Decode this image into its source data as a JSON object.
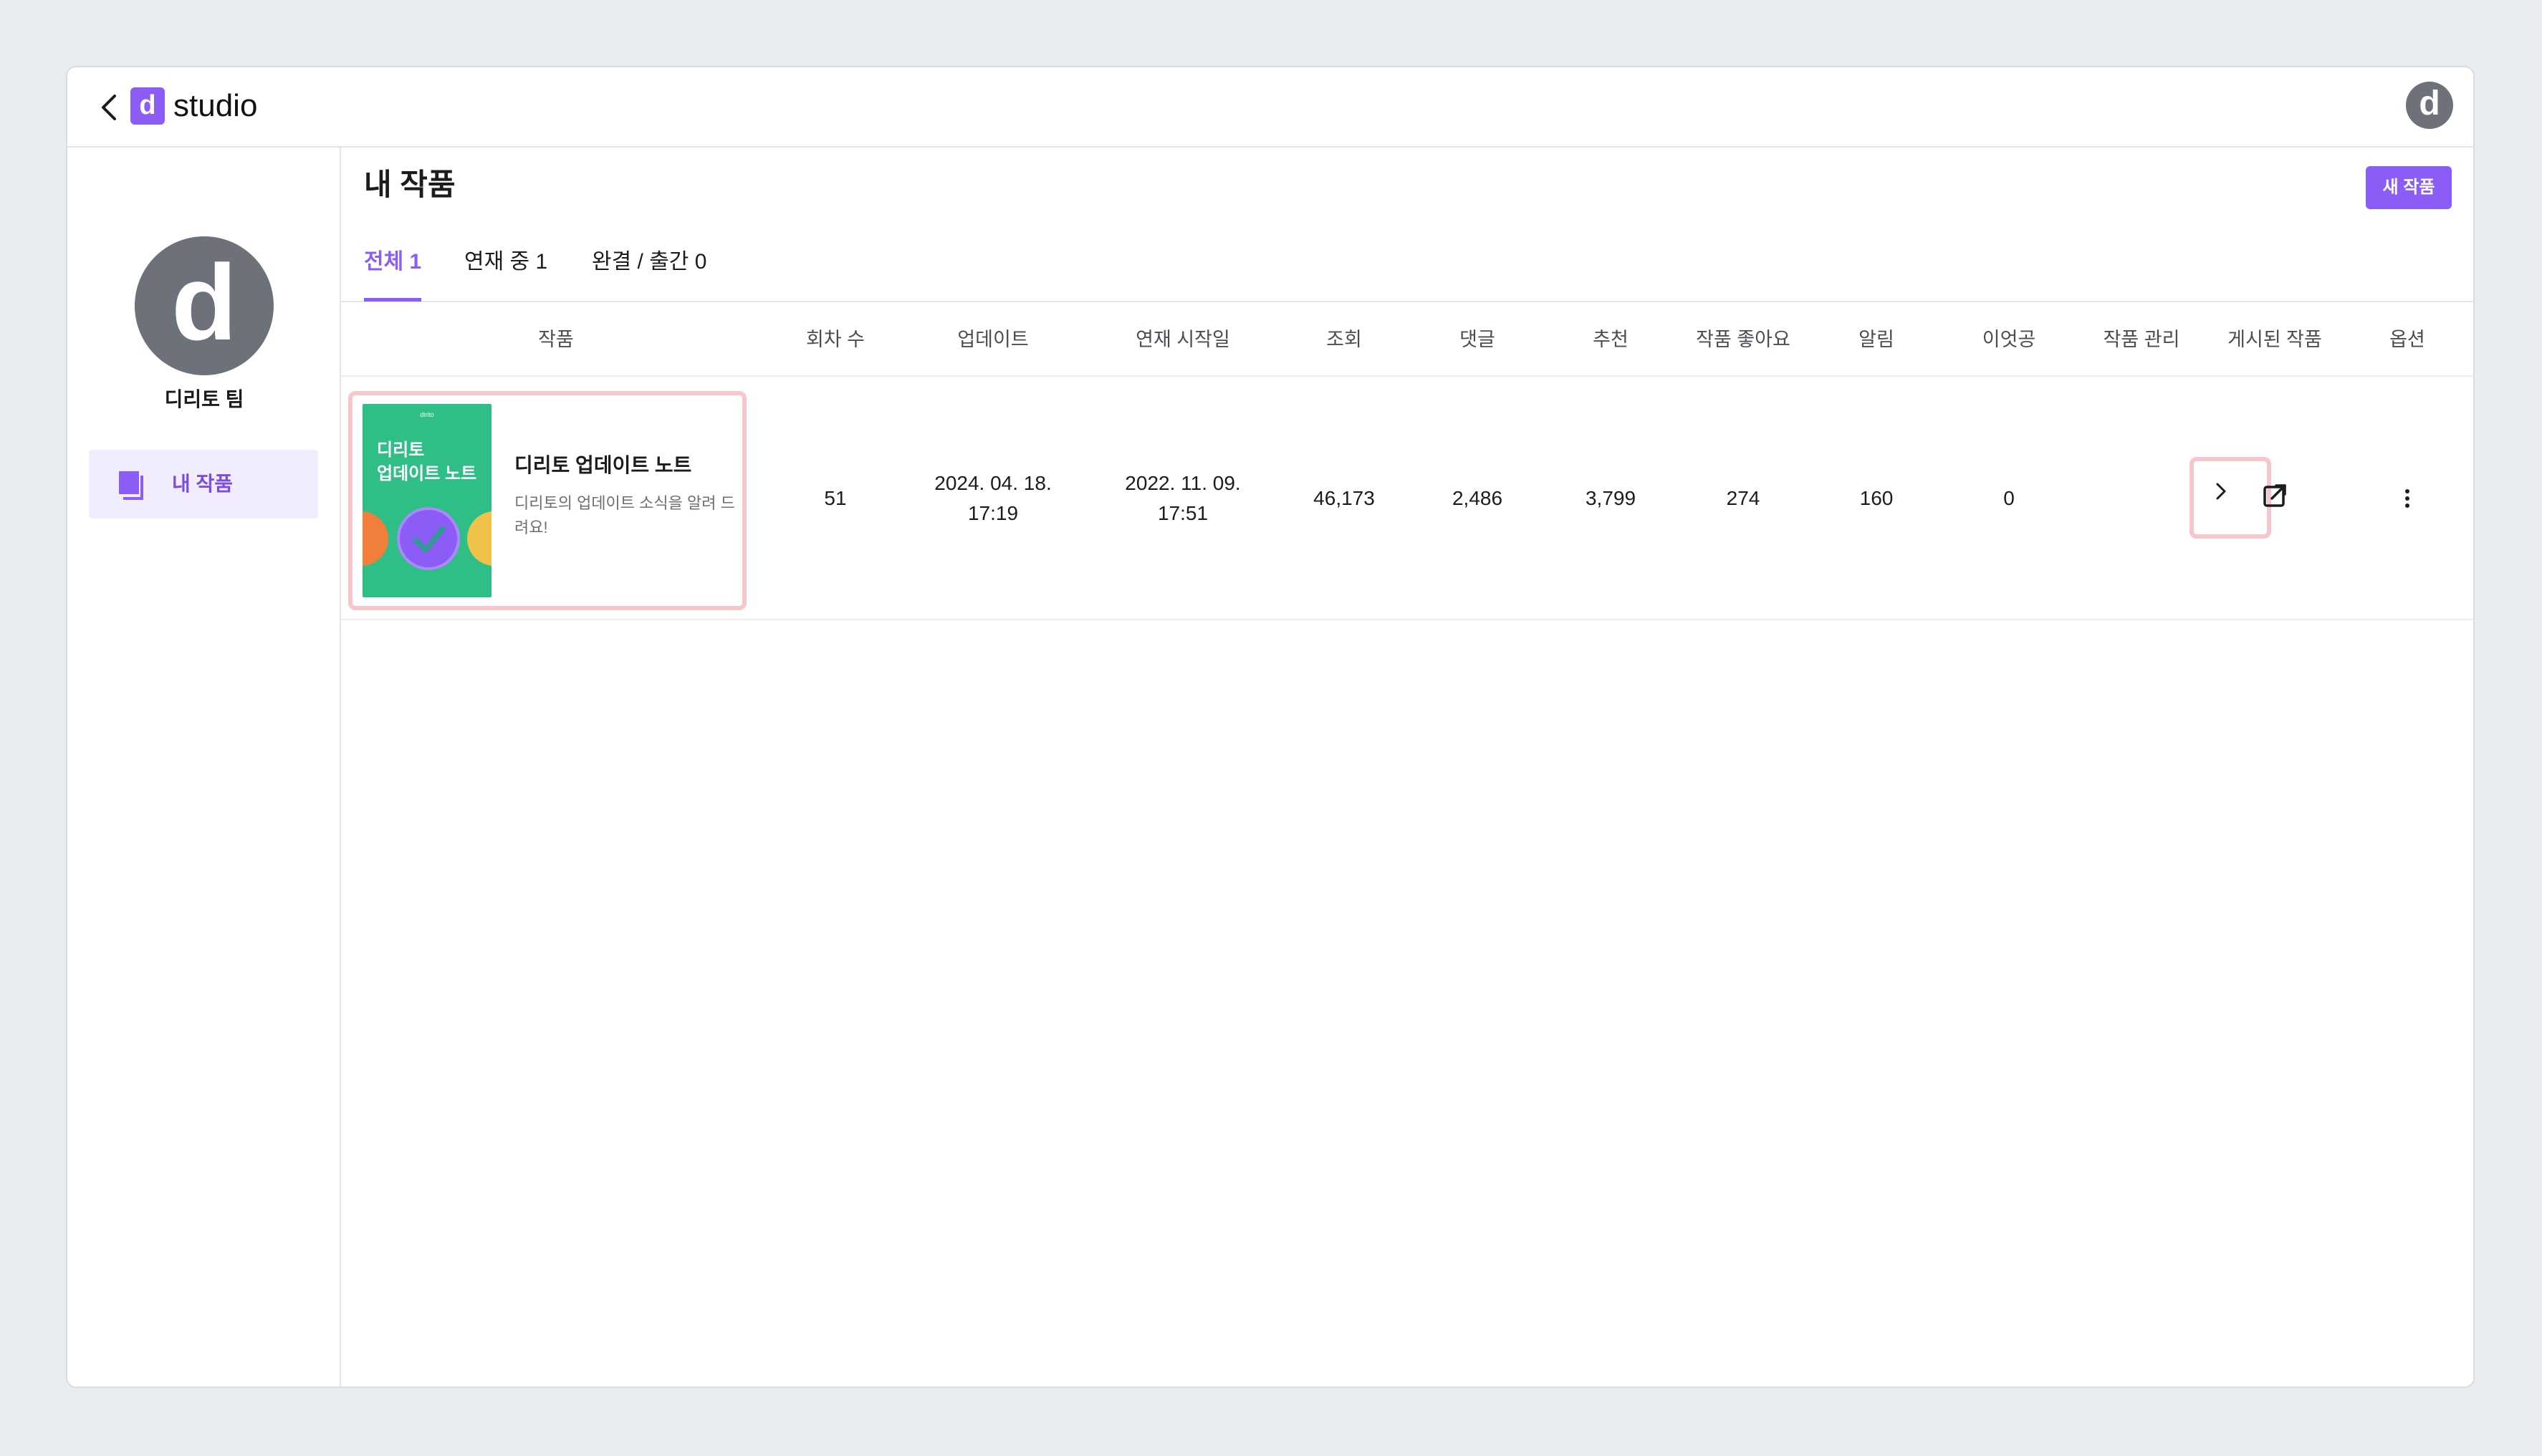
{
  "topbar": {
    "logo_letter": "d",
    "app_name": "studio",
    "avatar_letter": "d"
  },
  "sidebar": {
    "avatar_letter": "d",
    "team_name": "디리토 팀",
    "nav": [
      {
        "label": "내 작품",
        "icon": "document-stack-icon",
        "active": true
      }
    ]
  },
  "main": {
    "title": "내 작품",
    "new_button": "새 작품",
    "tabs": [
      {
        "label": "전체 1",
        "active": true
      },
      {
        "label": "연재 중 1",
        "active": false
      },
      {
        "label": "완결 / 출간 0",
        "active": false
      }
    ],
    "table": {
      "headers": [
        "작품",
        "회차 수",
        "업데이트",
        "연재 시작일",
        "조회",
        "댓글",
        "추천",
        "작품 좋아요",
        "알림",
        "이엇공",
        "작품 관리",
        "게시된 작품",
        "옵션"
      ],
      "rows": [
        {
          "cover_brand": "dirito",
          "cover_line1": "디리토",
          "cover_line2": "업데이트 노트",
          "title": "디리토 업데이트 노트",
          "description": "디리토의 업데이트 소식을 알려 드려요!",
          "episodes": "51",
          "updated_date": "2024. 04. 18.",
          "updated_time": "17:19",
          "started_date": "2022. 11. 09.",
          "started_time": "17:51",
          "views": "46,173",
          "comments": "2,486",
          "recommends": "3,799",
          "likes": "274",
          "notifications": "160",
          "ieotgong": "0",
          "manage_icon": "chevron-right-icon",
          "published_icon": "external-link-icon",
          "options_icon": "more-vertical-icon"
        }
      ]
    }
  },
  "colors": {
    "accent": "#8b5cf6",
    "highlight_border": "#f5c6ca",
    "cover_green": "#2fbf86",
    "avatar_gray": "#6c717a"
  }
}
